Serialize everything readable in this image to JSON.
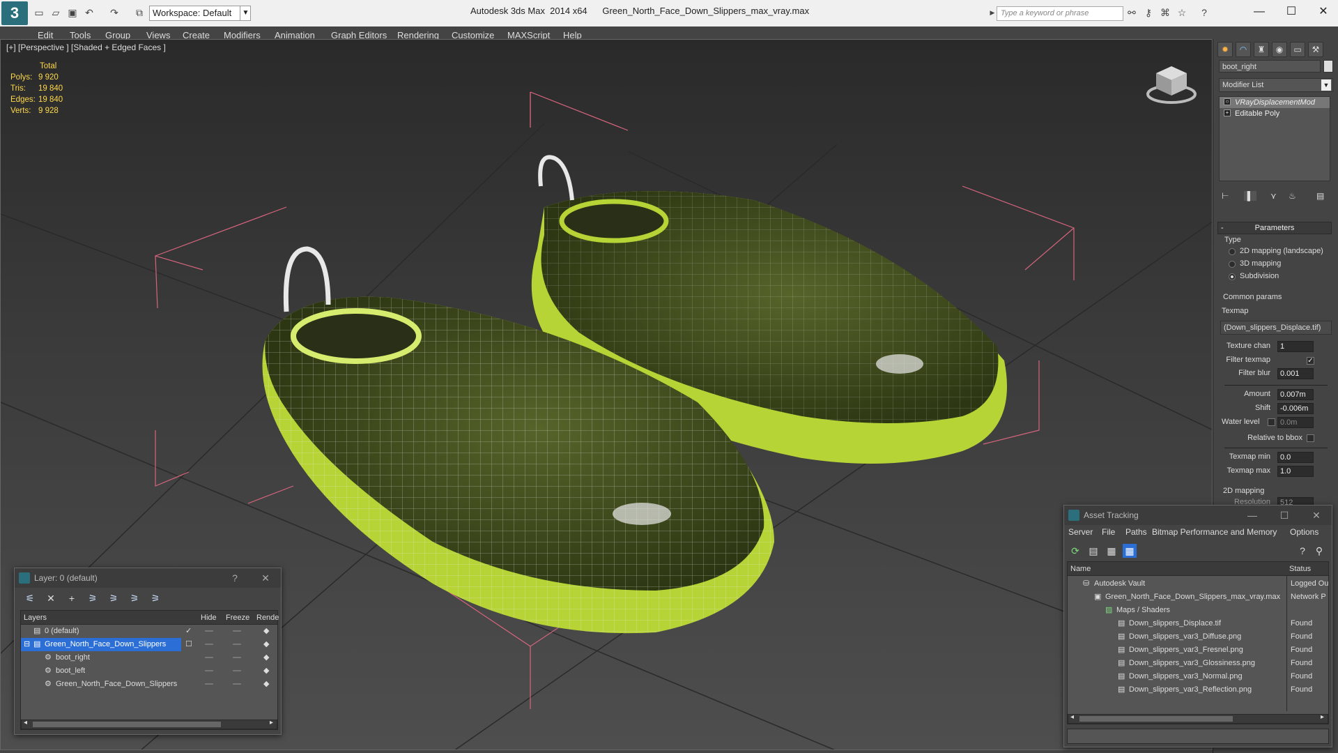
{
  "title_bar": {
    "app_title": "Autodesk 3ds Max  2014 x64",
    "file_name": "Green_North_Face_Down_Slippers_max_vray.max",
    "workspace": "Workspace: Default",
    "search_placeholder": "Type a keyword or phrase",
    "logo_glyph": "3"
  },
  "menu": [
    "Edit",
    "Tools",
    "Group",
    "Views",
    "Create",
    "Modifiers",
    "Animation",
    "Graph Editors",
    "Rendering",
    "Customize",
    "MAXScript",
    "Help"
  ],
  "viewport": {
    "label": "[+] [Perspective ] [Shaded + Edged Faces ]",
    "stats": {
      "header": "Total",
      "rows": [
        {
          "label": "Polys:",
          "value": "9 920"
        },
        {
          "label": "Tris:",
          "value": "19 840"
        },
        {
          "label": "Edges:",
          "value": "19 840"
        },
        {
          "label": "Verts:",
          "value": "9 928"
        }
      ]
    }
  },
  "command_panel": {
    "object_name": "boot_right",
    "modifier_list": "Modifier List",
    "stack": [
      "VRayDisplacementMod",
      "Editable Poly"
    ],
    "parameters_title": "Parameters",
    "type_label": "Type",
    "type_options": [
      {
        "label": "2D mapping (landscape)",
        "selected": false
      },
      {
        "label": "3D mapping",
        "selected": false
      },
      {
        "label": "Subdivision",
        "selected": true
      }
    ],
    "common_params": "Common params",
    "texmap_label": "Texmap",
    "texmap_value": "(Down_slippers_Displace.tif)",
    "texture_chan_label": "Texture chan",
    "texture_chan_value": "1",
    "filter_texmap_label": "Filter texmap",
    "filter_blur_label": "Filter blur",
    "filter_blur_value": "0.001",
    "amount_label": "Amount",
    "amount_value": "0.007m",
    "shift_label": "Shift",
    "shift_value": "-0.006m",
    "water_level_label": "Water level",
    "water_level_value": "0.0m",
    "relative_bbox_label": "Relative to bbox",
    "texmap_min_label": "Texmap min",
    "texmap_min_value": "0.0",
    "texmap_max_label": "Texmap max",
    "texmap_max_value": "1.0",
    "mapping_2d": "2D mapping",
    "resolution_label": "Resolution",
    "resolution_value": "512"
  },
  "layer_window": {
    "title": "Layer: 0 (default)",
    "help": "?",
    "columns": [
      "Layers",
      "Hide",
      "Freeze",
      "Rende"
    ],
    "rows": [
      {
        "name": "0 (default)",
        "indent": 1,
        "selected": false
      },
      {
        "name": "Green_North_Face_Down_Slippers",
        "indent": 1,
        "selected": true
      },
      {
        "name": "boot_right",
        "indent": 2,
        "selected": false
      },
      {
        "name": "boot_left",
        "indent": 2,
        "selected": false
      },
      {
        "name": "Green_North_Face_Down_Slippers",
        "indent": 2,
        "selected": false
      }
    ]
  },
  "asset_window": {
    "title": "Asset Tracking",
    "menu": [
      "Server",
      "File",
      "Paths",
      "Bitmap Performance and Memory",
      "Options"
    ],
    "columns": [
      "Name",
      "Status"
    ],
    "rows": [
      {
        "name": "Autodesk Vault",
        "status": "Logged Ou",
        "indent": 1
      },
      {
        "name": "Green_North_Face_Down_Slippers_max_vray.max",
        "status": "Network P",
        "indent": 2
      },
      {
        "name": "Maps / Shaders",
        "status": "",
        "indent": 3
      },
      {
        "name": "Down_slippers_Displace.tif",
        "status": "Found",
        "indent": 4
      },
      {
        "name": "Down_slippers_var3_Diffuse.png",
        "status": "Found",
        "indent": 4
      },
      {
        "name": "Down_slippers_var3_Fresnel.png",
        "status": "Found",
        "indent": 4
      },
      {
        "name": "Down_slippers_var3_Glossiness.png",
        "status": "Found",
        "indent": 4
      },
      {
        "name": "Down_slippers_var3_Normal.png",
        "status": "Found",
        "indent": 4
      },
      {
        "name": "Down_slippers_var3_Reflection.png",
        "status": "Found",
        "indent": 4
      }
    ]
  },
  "colors": {
    "stats_text": "#ffd94a",
    "selection": "#2b6fd6",
    "slipper_dark": "#3d4a1a",
    "slipper_lime": "#b7d436"
  }
}
